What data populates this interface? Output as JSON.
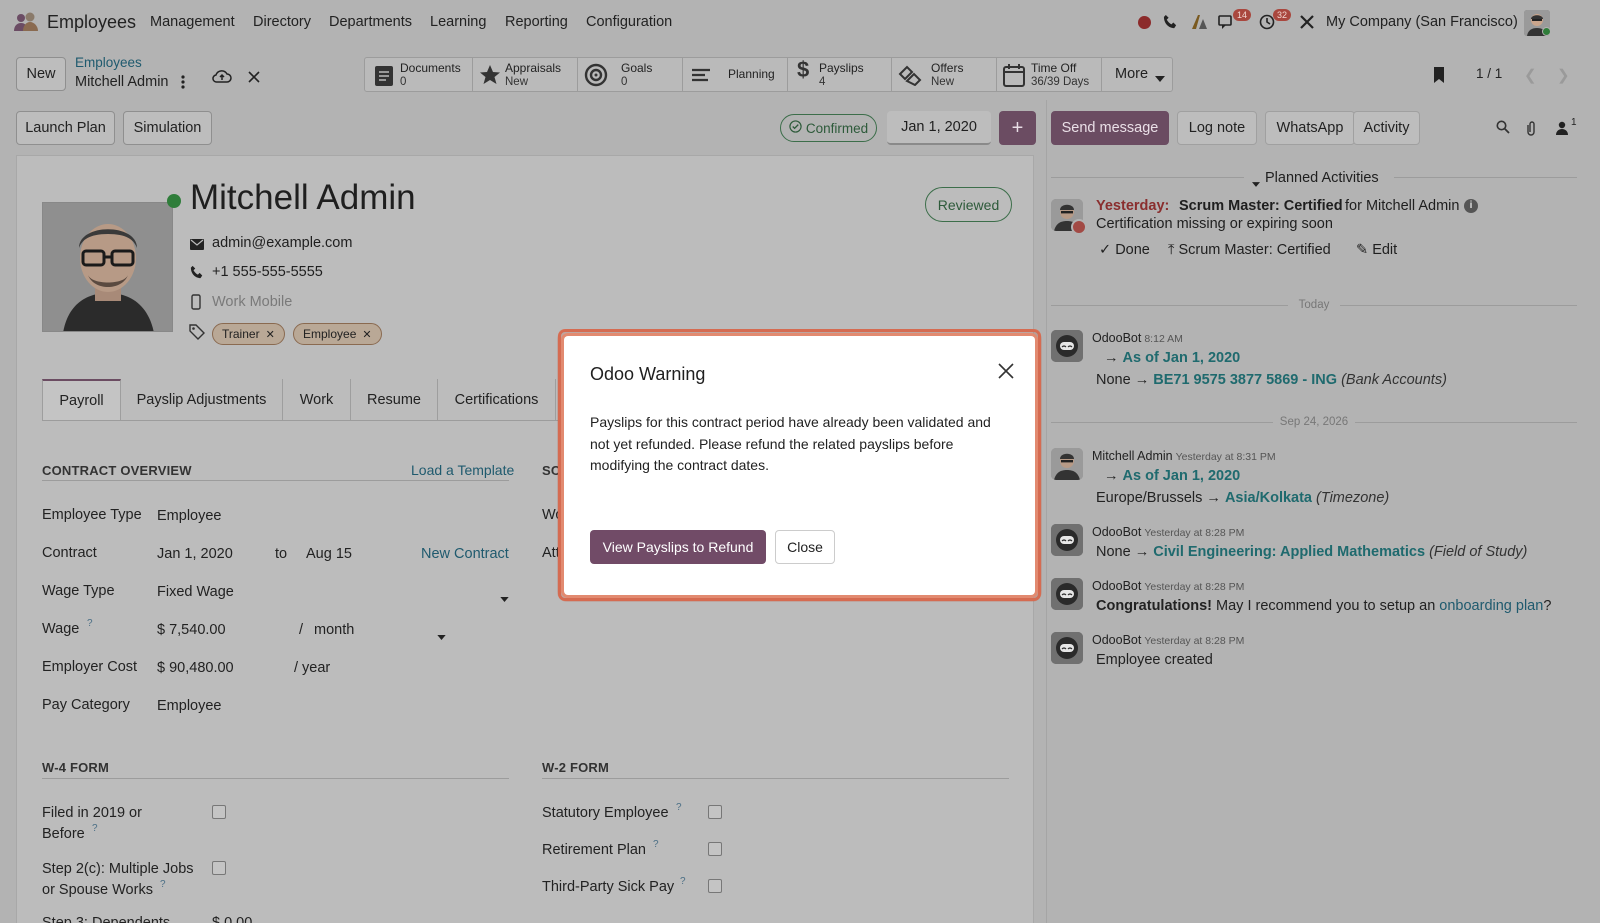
{
  "topbar": {
    "app_name": "Employees",
    "menus": [
      "Management",
      "Directory",
      "Departments",
      "Learning",
      "Reporting",
      "Configuration"
    ],
    "chat_badge": "14",
    "activity_badge": "32",
    "company": "My Company (San Francisco)"
  },
  "controlpanel": {
    "new_label": "New",
    "breadcrumb_parent": "Employees",
    "breadcrumb_current": "Mitchell Admin",
    "pager": "1 / 1"
  },
  "smart_buttons": [
    {
      "label": "Documents",
      "sub": "0",
      "icon": "documents-icon"
    },
    {
      "label": "Appraisals",
      "sub": "New",
      "icon": "star-icon"
    },
    {
      "label": "Goals",
      "sub": "0",
      "icon": "target-icon"
    },
    {
      "label": "Planning",
      "sub": "",
      "icon": "planning-icon"
    },
    {
      "label": "Payslips",
      "sub": "4",
      "icon": "dollar-icon"
    },
    {
      "label": "Offers",
      "sub": "New",
      "icon": "handshake-icon"
    },
    {
      "label": "Time Off",
      "sub": "36/39 Days",
      "icon": "calendar-icon"
    }
  ],
  "more_label": "More",
  "actions": {
    "launch_plan": "Launch Plan",
    "simulation": "Simulation",
    "confirmed": "Confirmed",
    "date": "Jan 1, 2020",
    "plus": "+"
  },
  "employee": {
    "name": "Mitchell Admin",
    "email": "admin@example.com",
    "phone": "+1 555-555-5555",
    "mobile_placeholder": "Work Mobile",
    "reviewed": "Reviewed",
    "tags": [
      "Trainer",
      "Employee"
    ]
  },
  "tabs": [
    "Payroll",
    "Payslip Adjustments",
    "Work",
    "Resume",
    "Certifications"
  ],
  "contract": {
    "section": "CONTRACT OVERVIEW",
    "load_template": "Load a Template",
    "employee_type_label": "Employee Type",
    "employee_type": "Employee",
    "contract_label": "Contract",
    "contract_start": "Jan 1, 2020",
    "to": "to",
    "contract_end": "Aug 15",
    "new_contract": "New Contract",
    "wage_type_label": "Wage Type",
    "wage_type": "Fixed Wage",
    "wage_label": "Wage",
    "wage": "$ 7,540.00",
    "slash": "/",
    "period": "month",
    "employer_cost_label": "Employer Cost",
    "employer_cost": "$ 90,480.00",
    "per_year": "/ year",
    "pay_category_label": "Pay Category",
    "pay_category": "Employee",
    "right_section_partial": "SC",
    "right_row1_partial": "Wo",
    "right_row2_partial": "Att"
  },
  "w4": {
    "section": "W-4 FORM",
    "filed_line1": "Filed in 2019 or",
    "filed_line2": "Before",
    "step2_line1": "Step 2(c): Multiple Jobs",
    "step2_line2": "or Spouse Works",
    "step3_partial": "Step 3: Dependents",
    "step3_value_partial": "$ 0.00"
  },
  "w2": {
    "section": "W-2 FORM",
    "statutory": "Statutory Employee",
    "retirement": "Retirement Plan",
    "sick_pay": "Third-Party Sick Pay"
  },
  "chatter": {
    "send_message": "Send message",
    "log_note": "Log note",
    "whatsapp": "WhatsApp",
    "activity": "Activity",
    "followers": "1",
    "planned": "Planned Activities",
    "activity_when": "Yesterday:",
    "activity_title": "Scrum Master: Certified",
    "activity_for": "for Mitchell Admin",
    "activity_note": "Certification missing or expiring soon",
    "done": "Done",
    "upload": "Scrum Master: Certified",
    "edit": "Edit",
    "sep_today": "Today",
    "sep_date": "Sep 24, 2026",
    "messages": [
      {
        "author": "OdooBot",
        "time": "8:12 AM",
        "line1_new": "As of Jan 1, 2020",
        "line2_old": "None",
        "line2_new": "BE71 9575 3877 5869 - ING",
        "line2_field": "(Bank Accounts)"
      },
      {
        "author": "Mitchell Admin",
        "time": "Yesterday at 8:31 PM",
        "line1_new": "As of Jan 1, 2020",
        "line2_old": "Europe/Brussels",
        "line2_new": "Asia/Kolkata",
        "line2_field": "(Timezone)"
      },
      {
        "author": "OdooBot",
        "time": "Yesterday at 8:28 PM",
        "line_old": "None",
        "line_new": "Civil Engineering: Applied Mathematics",
        "line_field": "(Field of Study)"
      },
      {
        "author": "OdooBot",
        "time": "Yesterday at 8:28 PM",
        "bold": "Congratulations!",
        "text": "May I recommend you to setup an",
        "link": "onboarding plan",
        "end": "?"
      },
      {
        "author": "OdooBot",
        "time": "Yesterday at 8:28 PM",
        "text": "Employee created"
      }
    ]
  },
  "dialog": {
    "title": "Odoo Warning",
    "body": "Payslips for this contract period have already been validated and not yet refunded. Please refund the related payslips before modifying the contract dates.",
    "primary": "View Payslips to Refund",
    "close": "Close"
  },
  "colors": {
    "overlay": "#b3b3b3",
    "primary": "#714b67",
    "teal": "#1f6a6e",
    "highlight": "#d9745a"
  }
}
